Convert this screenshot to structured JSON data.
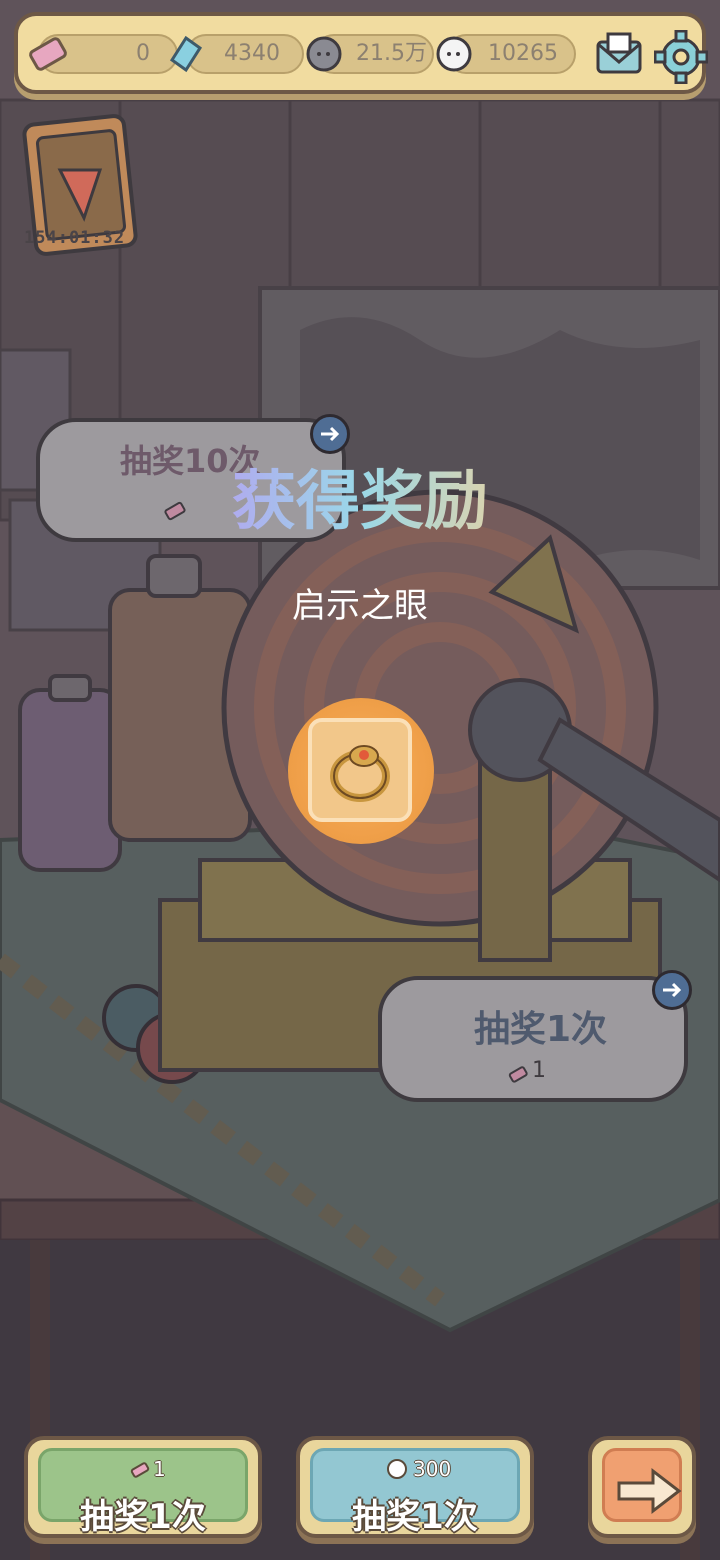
{
  "resources": {
    "ticket_value": "0",
    "crystal_value": "4340",
    "grey_coin_value": "21.5万",
    "white_coin_value": "10265"
  },
  "event": {
    "timer": "154:01:32"
  },
  "machine": {
    "draw10_label": "抽奖10次",
    "draw1_label": "抽奖1次",
    "draw1_cost": "1"
  },
  "reward": {
    "title": "获得奖励",
    "item_name": "启示之眼",
    "item_icon": "ring-icon"
  },
  "buttons": {
    "ticket_draw_cost": "1",
    "ticket_draw_label": "抽奖1次",
    "coin_draw_cost": "300",
    "coin_draw_label": "抽奖1次"
  },
  "colors": {
    "title_gradient": [
      "#e89ad8",
      "#b89af2",
      "#9ad8e8",
      "#f2d29a"
    ],
    "green_button": "#9cc48a",
    "blue_button": "#93c7d2",
    "orange_button": "#f0a071",
    "topbar": "#f1dca0"
  }
}
